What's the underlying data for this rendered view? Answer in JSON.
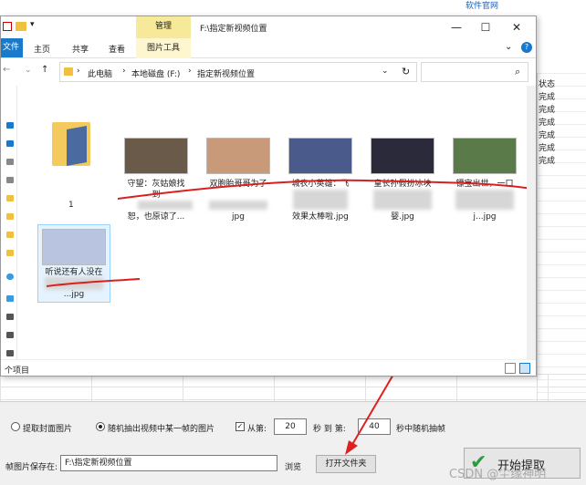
{
  "app": {
    "top_link": "软件官网",
    "status_header": "状态",
    "status_values": [
      "完成",
      "完成",
      "完成",
      "完成",
      "完成",
      "完成"
    ]
  },
  "options": {
    "extract_cover": "提取封面图片",
    "random_frame": "随机抽出视频中某一帧的图片",
    "from_label": "从第:",
    "from_value": "20",
    "sec_to": "秒 到 第:",
    "to_value": "40",
    "random_tail": "秒中随机抽帧",
    "save_label": "帧图片保存在:",
    "save_path": "F:\\指定新视频位置",
    "browse": "浏览",
    "open_folder": "打开文件夹",
    "start": "开始提取",
    "watermark": "CSDN @尘缘神明"
  },
  "explorer": {
    "window_title": "F:\\指定新视频位置",
    "ctx_tab": "管理",
    "ribbon_tabs": [
      "文件",
      "主页",
      "共享",
      "查看",
      "图片工具"
    ],
    "breadcrumb": [
      "此电脑",
      "本地磁盘 (F:)",
      "指定新视频位置"
    ],
    "status_count": "个项目",
    "items": [
      {
        "name": "1",
        "type": "folder"
      },
      {
        "line1": "守望：灰姑娘找",
        "line2": "到",
        "line3": "恕，也原谅了...",
        "thumb": "#6a5a4a"
      },
      {
        "line1": "双胞胎哥哥为了",
        "line2": "",
        "line3": "jpg",
        "thumb": "#c89a7a"
      },
      {
        "line1": "城农小英雄：飞",
        "line2": "",
        "line3": "效果太棒啦.jpg",
        "thumb": "#4a5a8a"
      },
      {
        "line1": "皇长孙假扮冰块",
        "line2": "",
        "line3": "婴.jpg",
        "thumb": "#2a2a3a"
      },
      {
        "line1": "镖宝出世，一口",
        "line2": "",
        "line3": "j...jpg",
        "thumb": "#5a7a4a"
      },
      {
        "line1": "听说还有人没在",
        "line2": "",
        "line3": "...jpg",
        "thumb": "#b8c4e0"
      }
    ]
  },
  "icons": {
    "back": "arrow-left-icon",
    "forward": "arrow-right-icon",
    "up": "arrow-up-icon",
    "refresh": "refresh-icon",
    "search": "search-icon",
    "help": "help-icon"
  }
}
